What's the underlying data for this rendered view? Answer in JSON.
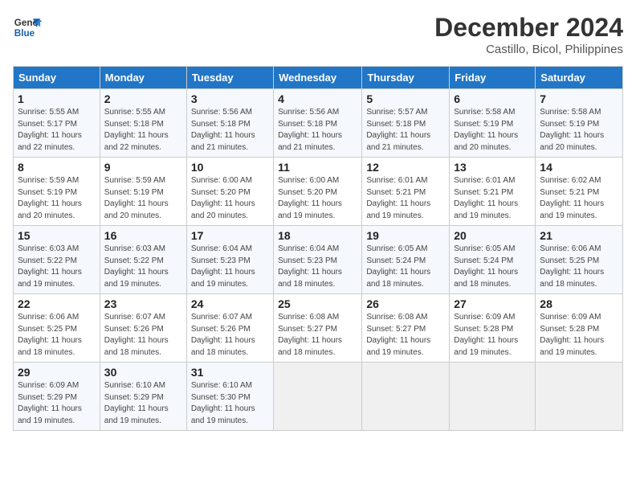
{
  "logo": {
    "line1": "General",
    "line2": "Blue"
  },
  "title": "December 2024",
  "location": "Castillo, Bicol, Philippines",
  "weekdays": [
    "Sunday",
    "Monday",
    "Tuesday",
    "Wednesday",
    "Thursday",
    "Friday",
    "Saturday"
  ],
  "weeks": [
    [
      {
        "day": "1",
        "sunrise": "5:55 AM",
        "sunset": "5:17 PM",
        "daylight": "11 hours and 22 minutes."
      },
      {
        "day": "2",
        "sunrise": "5:55 AM",
        "sunset": "5:18 PM",
        "daylight": "11 hours and 22 minutes."
      },
      {
        "day": "3",
        "sunrise": "5:56 AM",
        "sunset": "5:18 PM",
        "daylight": "11 hours and 21 minutes."
      },
      {
        "day": "4",
        "sunrise": "5:56 AM",
        "sunset": "5:18 PM",
        "daylight": "11 hours and 21 minutes."
      },
      {
        "day": "5",
        "sunrise": "5:57 AM",
        "sunset": "5:18 PM",
        "daylight": "11 hours and 21 minutes."
      },
      {
        "day": "6",
        "sunrise": "5:58 AM",
        "sunset": "5:19 PM",
        "daylight": "11 hours and 20 minutes."
      },
      {
        "day": "7",
        "sunrise": "5:58 AM",
        "sunset": "5:19 PM",
        "daylight": "11 hours and 20 minutes."
      }
    ],
    [
      {
        "day": "8",
        "sunrise": "5:59 AM",
        "sunset": "5:19 PM",
        "daylight": "11 hours and 20 minutes."
      },
      {
        "day": "9",
        "sunrise": "5:59 AM",
        "sunset": "5:19 PM",
        "daylight": "11 hours and 20 minutes."
      },
      {
        "day": "10",
        "sunrise": "6:00 AM",
        "sunset": "5:20 PM",
        "daylight": "11 hours and 20 minutes."
      },
      {
        "day": "11",
        "sunrise": "6:00 AM",
        "sunset": "5:20 PM",
        "daylight": "11 hours and 19 minutes."
      },
      {
        "day": "12",
        "sunrise": "6:01 AM",
        "sunset": "5:21 PM",
        "daylight": "11 hours and 19 minutes."
      },
      {
        "day": "13",
        "sunrise": "6:01 AM",
        "sunset": "5:21 PM",
        "daylight": "11 hours and 19 minutes."
      },
      {
        "day": "14",
        "sunrise": "6:02 AM",
        "sunset": "5:21 PM",
        "daylight": "11 hours and 19 minutes."
      }
    ],
    [
      {
        "day": "15",
        "sunrise": "6:03 AM",
        "sunset": "5:22 PM",
        "daylight": "11 hours and 19 minutes."
      },
      {
        "day": "16",
        "sunrise": "6:03 AM",
        "sunset": "5:22 PM",
        "daylight": "11 hours and 19 minutes."
      },
      {
        "day": "17",
        "sunrise": "6:04 AM",
        "sunset": "5:23 PM",
        "daylight": "11 hours and 19 minutes."
      },
      {
        "day": "18",
        "sunrise": "6:04 AM",
        "sunset": "5:23 PM",
        "daylight": "11 hours and 18 minutes."
      },
      {
        "day": "19",
        "sunrise": "6:05 AM",
        "sunset": "5:24 PM",
        "daylight": "11 hours and 18 minutes."
      },
      {
        "day": "20",
        "sunrise": "6:05 AM",
        "sunset": "5:24 PM",
        "daylight": "11 hours and 18 minutes."
      },
      {
        "day": "21",
        "sunrise": "6:06 AM",
        "sunset": "5:25 PM",
        "daylight": "11 hours and 18 minutes."
      }
    ],
    [
      {
        "day": "22",
        "sunrise": "6:06 AM",
        "sunset": "5:25 PM",
        "daylight": "11 hours and 18 minutes."
      },
      {
        "day": "23",
        "sunrise": "6:07 AM",
        "sunset": "5:26 PM",
        "daylight": "11 hours and 18 minutes."
      },
      {
        "day": "24",
        "sunrise": "6:07 AM",
        "sunset": "5:26 PM",
        "daylight": "11 hours and 18 minutes."
      },
      {
        "day": "25",
        "sunrise": "6:08 AM",
        "sunset": "5:27 PM",
        "daylight": "11 hours and 18 minutes."
      },
      {
        "day": "26",
        "sunrise": "6:08 AM",
        "sunset": "5:27 PM",
        "daylight": "11 hours and 19 minutes."
      },
      {
        "day": "27",
        "sunrise": "6:09 AM",
        "sunset": "5:28 PM",
        "daylight": "11 hours and 19 minutes."
      },
      {
        "day": "28",
        "sunrise": "6:09 AM",
        "sunset": "5:28 PM",
        "daylight": "11 hours and 19 minutes."
      }
    ],
    [
      {
        "day": "29",
        "sunrise": "6:09 AM",
        "sunset": "5:29 PM",
        "daylight": "11 hours and 19 minutes."
      },
      {
        "day": "30",
        "sunrise": "6:10 AM",
        "sunset": "5:29 PM",
        "daylight": "11 hours and 19 minutes."
      },
      {
        "day": "31",
        "sunrise": "6:10 AM",
        "sunset": "5:30 PM",
        "daylight": "11 hours and 19 minutes."
      },
      null,
      null,
      null,
      null
    ]
  ]
}
